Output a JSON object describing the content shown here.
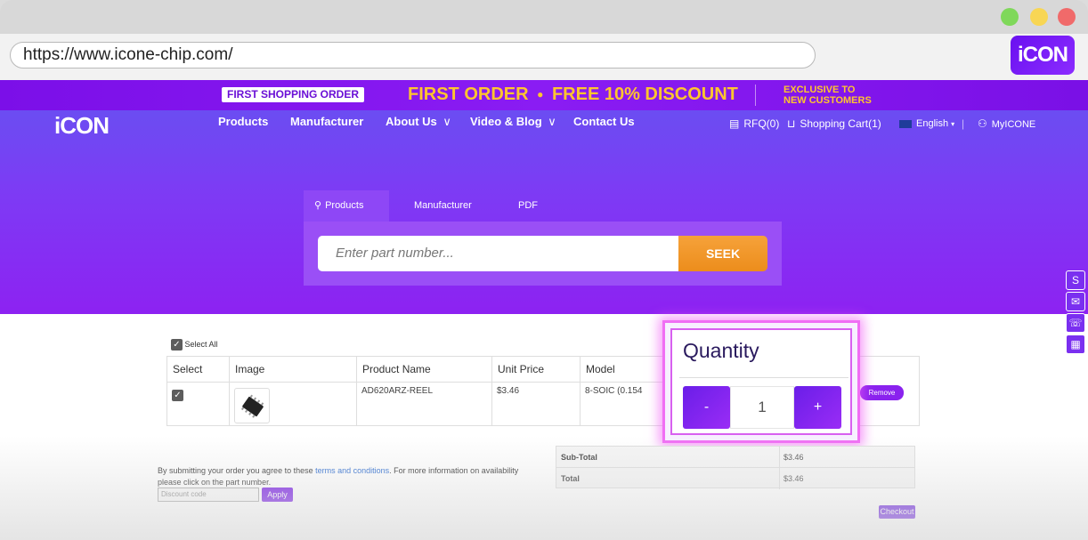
{
  "browser": {
    "url": "https://www.icone-chip.com/",
    "logo_text": "iCON"
  },
  "promo": {
    "tag": "FIRST SHOPPING ORDER",
    "headline_left": "FIRST ORDER",
    "headline_right": "FREE 10% DISCOUNT",
    "side_line1": "EXCLUSIVE TO",
    "side_line2": "NEW CUSTOMERS"
  },
  "header": {
    "logo_text": "iCON",
    "nav": {
      "products": "Products",
      "manufacturer": "Manufacturer",
      "about": "About Us",
      "video": "Video & Blog",
      "contact": "Contact Us"
    },
    "rfq": "RFQ(0)",
    "cart": "Shopping Cart(1)",
    "language": "English",
    "account": "MyICONE"
  },
  "search": {
    "tabs": [
      "Products",
      "Manufacturer",
      "PDF"
    ],
    "placeholder": "Enter part number...",
    "button": "SEEK"
  },
  "cart": {
    "select_all": "Select All",
    "columns": [
      "Select",
      "Image",
      "Product Name",
      "Unit Price",
      "Model"
    ],
    "row": {
      "product_name": "AD620ARZ-REEL",
      "unit_price": "$3.46",
      "model": "8-SOIC (0.154"
    },
    "remove_label": "Remove"
  },
  "quantity": {
    "title": "Quantity",
    "minus": "-",
    "value": "1",
    "plus": "+"
  },
  "summary": {
    "terms_prefix": "By submitting your order you agree to these ",
    "terms_link": "terms and conditions",
    "terms_suffix": ". For more information on availability please click on the part number.",
    "discount_placeholder": "Discount code",
    "apply": "Apply",
    "subtotal_label": "Sub-Total",
    "subtotal_value": "$3.46",
    "total_label": "Total",
    "total_value": "$3.46",
    "checkout": "Checkout"
  },
  "colors": {
    "brand_purple": "#8a1cf3",
    "accent_orange": "#ec8d1c",
    "promo_yellow": "#ffc52e"
  }
}
